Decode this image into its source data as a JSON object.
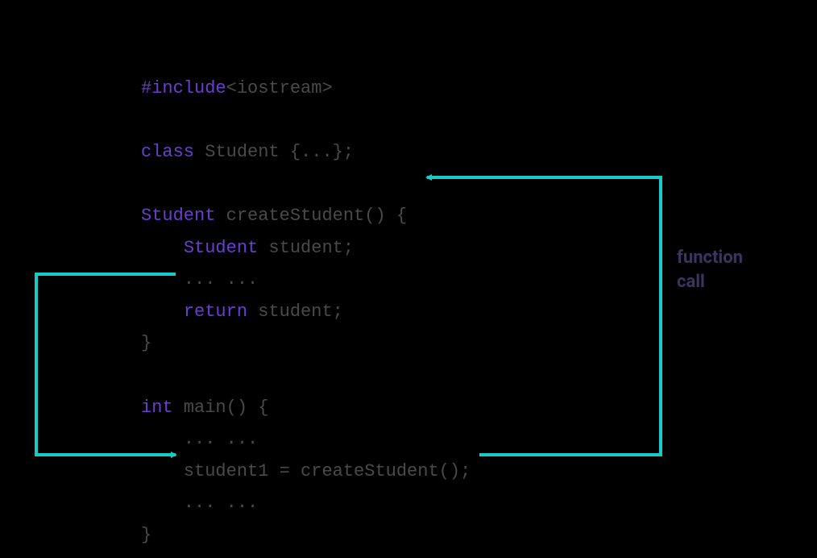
{
  "code": {
    "l1": {
      "kw": "#include",
      "hdr": "<iostream>"
    },
    "l2": {
      "kw": "class",
      "name": " Student ",
      "rest": "{...};"
    },
    "l3": {
      "type": "Student",
      "name": " createStudent() ",
      "brace": "{"
    },
    "l4": {
      "type": "Student",
      "name": " student;"
    },
    "l5": {
      "dots": "... ..."
    },
    "l6": {
      "kw": "return",
      "name": " student;"
    },
    "l7": {
      "brace": "}"
    },
    "l8": {
      "type": "int",
      "name": " main() ",
      "brace": "{"
    },
    "l9": {
      "dots": "... ..."
    },
    "l10": {
      "stmt": "student1 = createStudent();"
    },
    "l11": {
      "dots": "... ..."
    },
    "l12": {
      "brace": "}"
    }
  },
  "annotation": {
    "function_call_1": "function",
    "function_call_2": "call"
  },
  "colors": {
    "arrow": "#17ccc4",
    "keyword": "#6c3dd4",
    "ident": "#4a4a4a",
    "label": "#3a3560"
  }
}
